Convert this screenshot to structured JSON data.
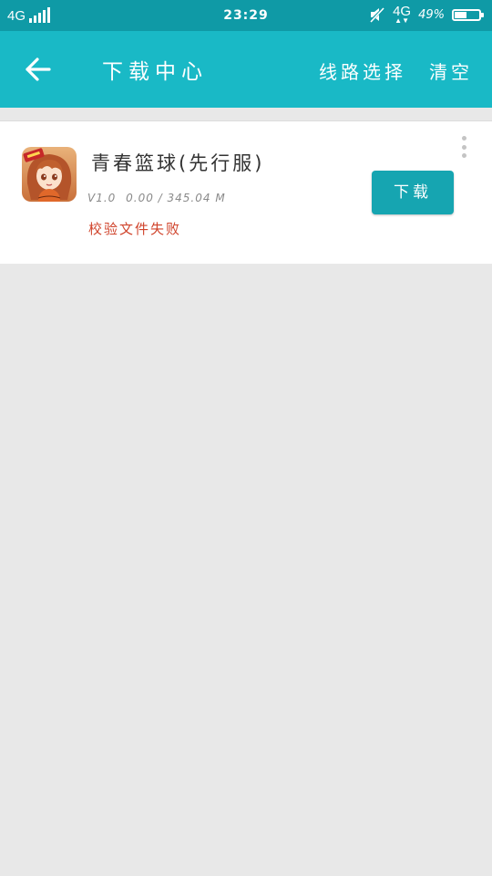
{
  "status_bar": {
    "network_left": "4G",
    "time": "23:29",
    "network_right": "4G",
    "battery_text": "49%",
    "battery_level": 0.49
  },
  "header": {
    "title": "下载中心",
    "route_select_label": "线路选择",
    "clear_label": "清空",
    "background": "#19b9c6"
  },
  "downloads": [
    {
      "name": "青春篮球(先行服)",
      "version": "V1.0",
      "progress_text": "0.00 / 345.04 M",
      "error": "校验文件失败",
      "button_label": "下载",
      "icon": "anime-girl-basketball-app-icon",
      "button_color": "#16a5b1",
      "error_color": "#d0442c"
    }
  ]
}
